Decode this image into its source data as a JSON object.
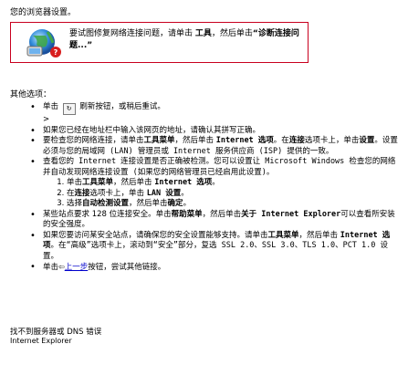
{
  "top_text": "您的浏览器设置。",
  "diagnose": {
    "text_a": "要试图修复网络连接问题，请单击 ",
    "tools": "工具",
    "text_b": "，然后单击",
    "quote_diag": "“诊断连接问题...”"
  },
  "other_options_label": "其他选项：",
  "options": {
    "refresh_a": "单击",
    "refresh_b": "刷新按钮，或稍后重试。",
    "refresh_mark": ">",
    "address": "如果您已经在地址栏中输入该网页的地址，请确认其拼写正确。",
    "network_a": "要检查您的网络连接，请单击",
    "tools_menu": "工具菜单",
    "network_b": "，然后单击 ",
    "internet_options": "Internet 选项",
    "network_c": "。在",
    "connections_tab": "连接",
    "network_d": "选项卡上，单击",
    "settings": "设置",
    "network_e": "。设置必须与您的局域网 (LAN) 管理员或 Internet 服务供应商 (ISP) 提供的一致。",
    "detect_a": "查看您的 Internet 连接设置是否正确被检测。您可以设置让 Microsoft Windows 检查您的网络并自动发现网络连接设置 (如果您的网络管理员已经启用此设置)。",
    "steps": [
      {
        "a": "单击",
        "b": "工具菜单",
        "c": "，然后单击 ",
        "d": "Internet 选项",
        "e": "。"
      },
      {
        "a": "在",
        "b": "连接",
        "c": "选项卡上，单击 ",
        "d": "LAN 设置",
        "e": "。"
      },
      {
        "a": "选择",
        "b": "自动检测设置",
        "c": "，然后单击",
        "d": "确定",
        "e": "。"
      }
    ],
    "ssl_a": "某些站点要求 128 位连接安全。单击",
    "help_menu": "帮助菜单",
    "ssl_b": "，然后单击",
    "about_ie": "关于 Internet Explorer",
    "ssl_c": "可以查看所安装的安全强度。",
    "secure_a": "如果您要访问某安全站点，请确保您的安全设置能够支持。请单击",
    "tools_menu2": "工具菜单",
    "secure_b": "，然后单击 ",
    "internet_options2": "Internet 选项",
    "secure_c": "。在“高级”选项卡上，滚动到“安全”部分，复选 SSL 2.0、SSL 3.0、TLS 1.0、PCT 1.0 设置。",
    "back_a": "单击",
    "back_link": "上一步",
    "back_b": "按钮，尝试其他链接。"
  },
  "bottom": {
    "line1": "找不到服务器或 DNS 错误",
    "line2": "Internet Explorer"
  }
}
